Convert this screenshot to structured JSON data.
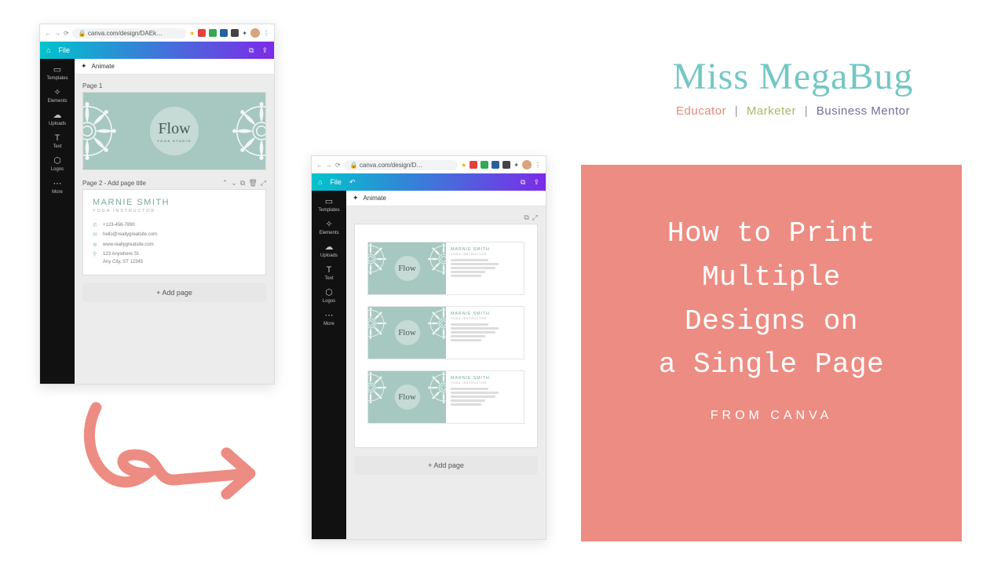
{
  "brand": {
    "name": "Miss MegaBug",
    "tags": {
      "t1": "Educator",
      "t2": "Marketer",
      "t3": "Business Mentor"
    }
  },
  "title_card": {
    "line1": "How to Print",
    "line2": "Multiple",
    "line3": "Designs on",
    "line4": "a Single Page",
    "sub": "FROM CANVA"
  },
  "canva": {
    "url_a": "canva.com/design/DAEk…",
    "url_b": "canva.com/design/D…",
    "file": "File",
    "animate": "Animate",
    "sidebar": [
      {
        "icon": "▭",
        "label": "Templates"
      },
      {
        "icon": "✧",
        "label": "Elements"
      },
      {
        "icon": "☁",
        "label": "Uploads"
      },
      {
        "icon": "T",
        "label": "Text"
      },
      {
        "icon": "⬡",
        "label": "Logos"
      },
      {
        "icon": "⋯",
        "label": "More"
      }
    ],
    "page1_label": "Page 1",
    "page2_label": "Page 2 - Add page title",
    "add_page": "+ Add page",
    "flow": {
      "title": "Flow",
      "sub": "YOGA STUDIO"
    },
    "marnie": {
      "name": "MARNIE SMITH",
      "role": "YOGA INSTRUCTOR",
      "phone": "+123-456-7890",
      "email": "hello@reallygreatsite.com",
      "site": "www.reallygreatsite.com",
      "addr1": "123 Anywhere St.",
      "addr2": "Any City, ST 12345"
    }
  }
}
